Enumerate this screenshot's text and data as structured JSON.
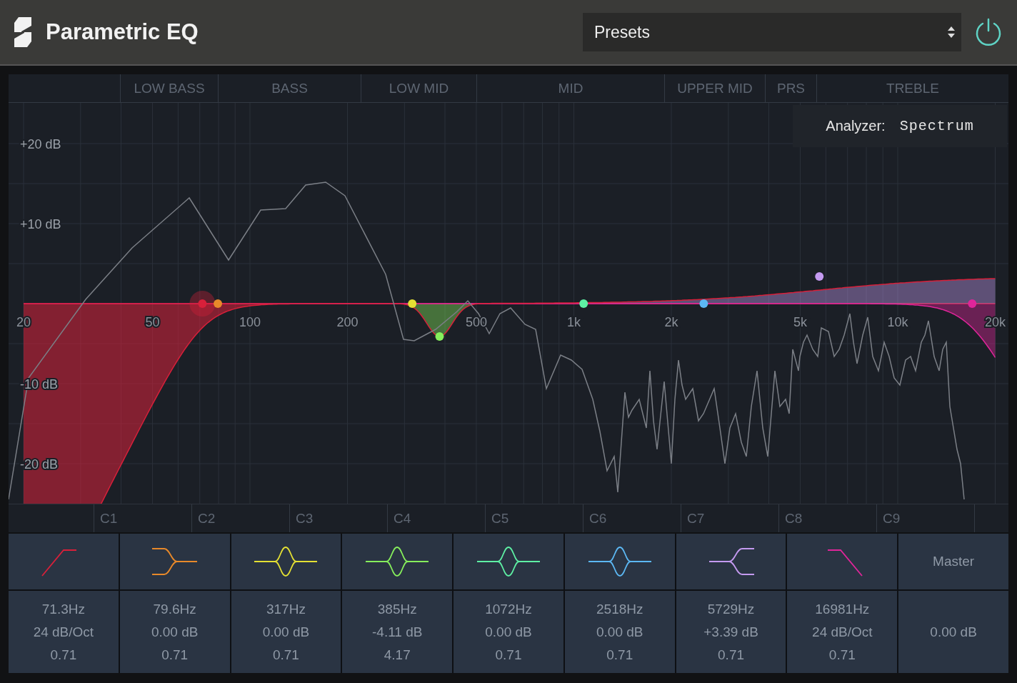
{
  "header": {
    "title": "Parametric EQ",
    "presets": "Presets",
    "power_on": true
  },
  "regions": [
    "LOW BASS",
    "BASS",
    "LOW MID",
    "MID",
    "UPPER MID",
    "PRS",
    "TREBLE"
  ],
  "analyzer": {
    "label": "Analyzer:",
    "value": "Spectrum"
  },
  "db_labels": [
    "+20 dB",
    "+10 dB",
    "-10 dB",
    "-20 dB"
  ],
  "freq_labels": [
    "20",
    "50",
    "100",
    "200",
    "500",
    "1k",
    "2k",
    "5k",
    "10k",
    "20k"
  ],
  "graph_handles": [
    {
      "selected": true
    },
    {
      "selected": false
    },
    {
      "selected": false
    },
    {
      "selected": false
    },
    {
      "selected": false
    },
    {
      "selected": false
    },
    {
      "selected": false
    },
    {
      "selected": false
    }
  ],
  "octaves": [
    "C1",
    "C2",
    "C3",
    "C4",
    "C5",
    "C6",
    "C7",
    "C8",
    "C9"
  ],
  "bands": [
    {
      "kind": "lowcut",
      "color": "#d8203a",
      "freq": "71.3Hz",
      "gain": "24 dB/Oct",
      "q": "0.71"
    },
    {
      "kind": "lowshelf",
      "color": "#e8892a",
      "freq": "79.6Hz",
      "gain": "0.00 dB",
      "q": "0.71"
    },
    {
      "kind": "bell",
      "color": "#e4e033",
      "freq": "317Hz",
      "gain": "0.00 dB",
      "q": "0.71"
    },
    {
      "kind": "bell",
      "color": "#86ee5c",
      "freq": "385Hz",
      "gain": "-4.11 dB",
      "q": "4.17"
    },
    {
      "kind": "bell",
      "color": "#5ef0a4",
      "freq": "1072Hz",
      "gain": "0.00 dB",
      "q": "0.71"
    },
    {
      "kind": "bell",
      "color": "#5cb8f4",
      "freq": "2518Hz",
      "gain": "0.00 dB",
      "q": "0.71"
    },
    {
      "kind": "highshelf",
      "color": "#c49af0",
      "freq": "5729Hz",
      "gain": "+3.39 dB",
      "q": "0.71"
    },
    {
      "kind": "highcut",
      "color": "#e0259a",
      "freq": "16981Hz",
      "gain": "24 dB/Oct",
      "q": "0.71"
    }
  ],
  "master": {
    "label": "Master",
    "gain": "0.00 dB"
  }
}
